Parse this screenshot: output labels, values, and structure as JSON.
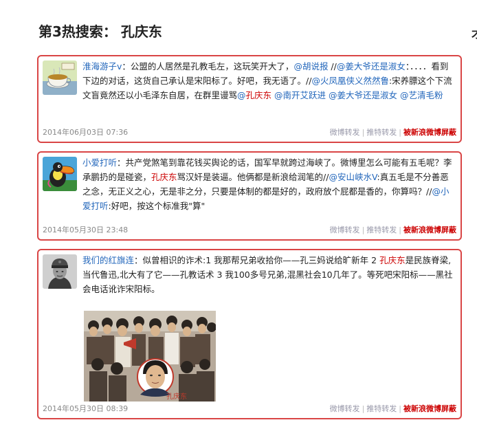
{
  "heading": {
    "label": "第3热搜索：",
    "name": "孔庆东"
  },
  "edge_glyph": "才",
  "posts": [
    {
      "user": "淮海游子v",
      "parts": [
        {
          "t": "colon",
          "v": "："
        },
        {
          "t": "text",
          "v": "公盟的人居然是孔教毛左，这玩笑开大了，"
        },
        {
          "t": "mention",
          "v": "@胡说报"
        },
        {
          "t": "text",
          "v": " //"
        },
        {
          "t": "mention",
          "v": "@姜大爷还是淑女"
        },
        {
          "t": "text",
          "v": "：．．．．看到下边的对话，这货自己承认是宋阳标了。好吧，我无语了。//"
        },
        {
          "t": "mention",
          "v": "@火凤凰侠义然然鲁"
        },
        {
          "t": "text",
          "v": ":宋养膘这个下流文盲竟然还以小毛泽东自居，在群里谩骂"
        },
        {
          "t": "mention",
          "v": "@"
        },
        {
          "t": "kw",
          "v": "孔庆东"
        },
        {
          "t": "text",
          "v": " "
        },
        {
          "t": "mention",
          "v": "@南开艾跃进"
        },
        {
          "t": "text",
          "v": " "
        },
        {
          "t": "mention",
          "v": "@姜大爷还是淑女"
        },
        {
          "t": "text",
          "v": " "
        },
        {
          "t": "mention",
          "v": "@艺清毛粉"
        }
      ],
      "date": "2014年06月03日 07:36"
    },
    {
      "user": "小爱打听",
      "parts": [
        {
          "t": "colon",
          "v": "："
        },
        {
          "t": "text",
          "v": "共产党煞笔到靠花钱买舆论的话，国军早就跨过海峡了。微博里怎么可能有五毛呢？李承鹏扔的是碰瓷，"
        },
        {
          "t": "kw",
          "v": "孔庆东"
        },
        {
          "t": "text",
          "v": "骂汉奸是装逼。他俩都是新浪给润笔的//"
        },
        {
          "t": "mention",
          "v": "@安山峡水V"
        },
        {
          "t": "text",
          "v": ":真五毛是不分善恶之念，无正义之心，无是非之分，只要是体制的都是好的，政府放个屁都是香的，你算吗？//"
        },
        {
          "t": "mention",
          "v": "@小爱打听"
        },
        {
          "t": "text",
          "v": ":好吧，按这个标准我\"算\""
        }
      ],
      "date": "2014年05月30日 23:48"
    },
    {
      "user": "我们的红旗连",
      "parts": [
        {
          "t": "colon",
          "v": "："
        },
        {
          "t": "text",
          "v": "似曾相识的诈术:1 我那帮兄弟收拾你——孔三妈说给旷新年 2 "
        },
        {
          "t": "kw",
          "v": "孔庆东"
        },
        {
          "t": "text",
          "v": "是民族脊梁,当代鲁迅,北大有了它——孔教话术 3 我100多号兄弟,混黑社会10几年了。等死吧宋阳标——黑社会电话讹诈宋阳标。"
        }
      ],
      "date": "2014年05月30日 08:39",
      "photo_stamp": "孔庆东"
    }
  ],
  "actions": {
    "forward": "微博转发",
    "twitter": "推特转发",
    "blocked": "被新浪微博屏蔽"
  },
  "colors": {
    "border": "#d94545",
    "link": "#2266bb",
    "keyword": "#cc0000"
  },
  "icons": [
    "teacup-avatar",
    "toucan-avatar",
    "soldier-portrait-avatar",
    "crowd-photo"
  ]
}
